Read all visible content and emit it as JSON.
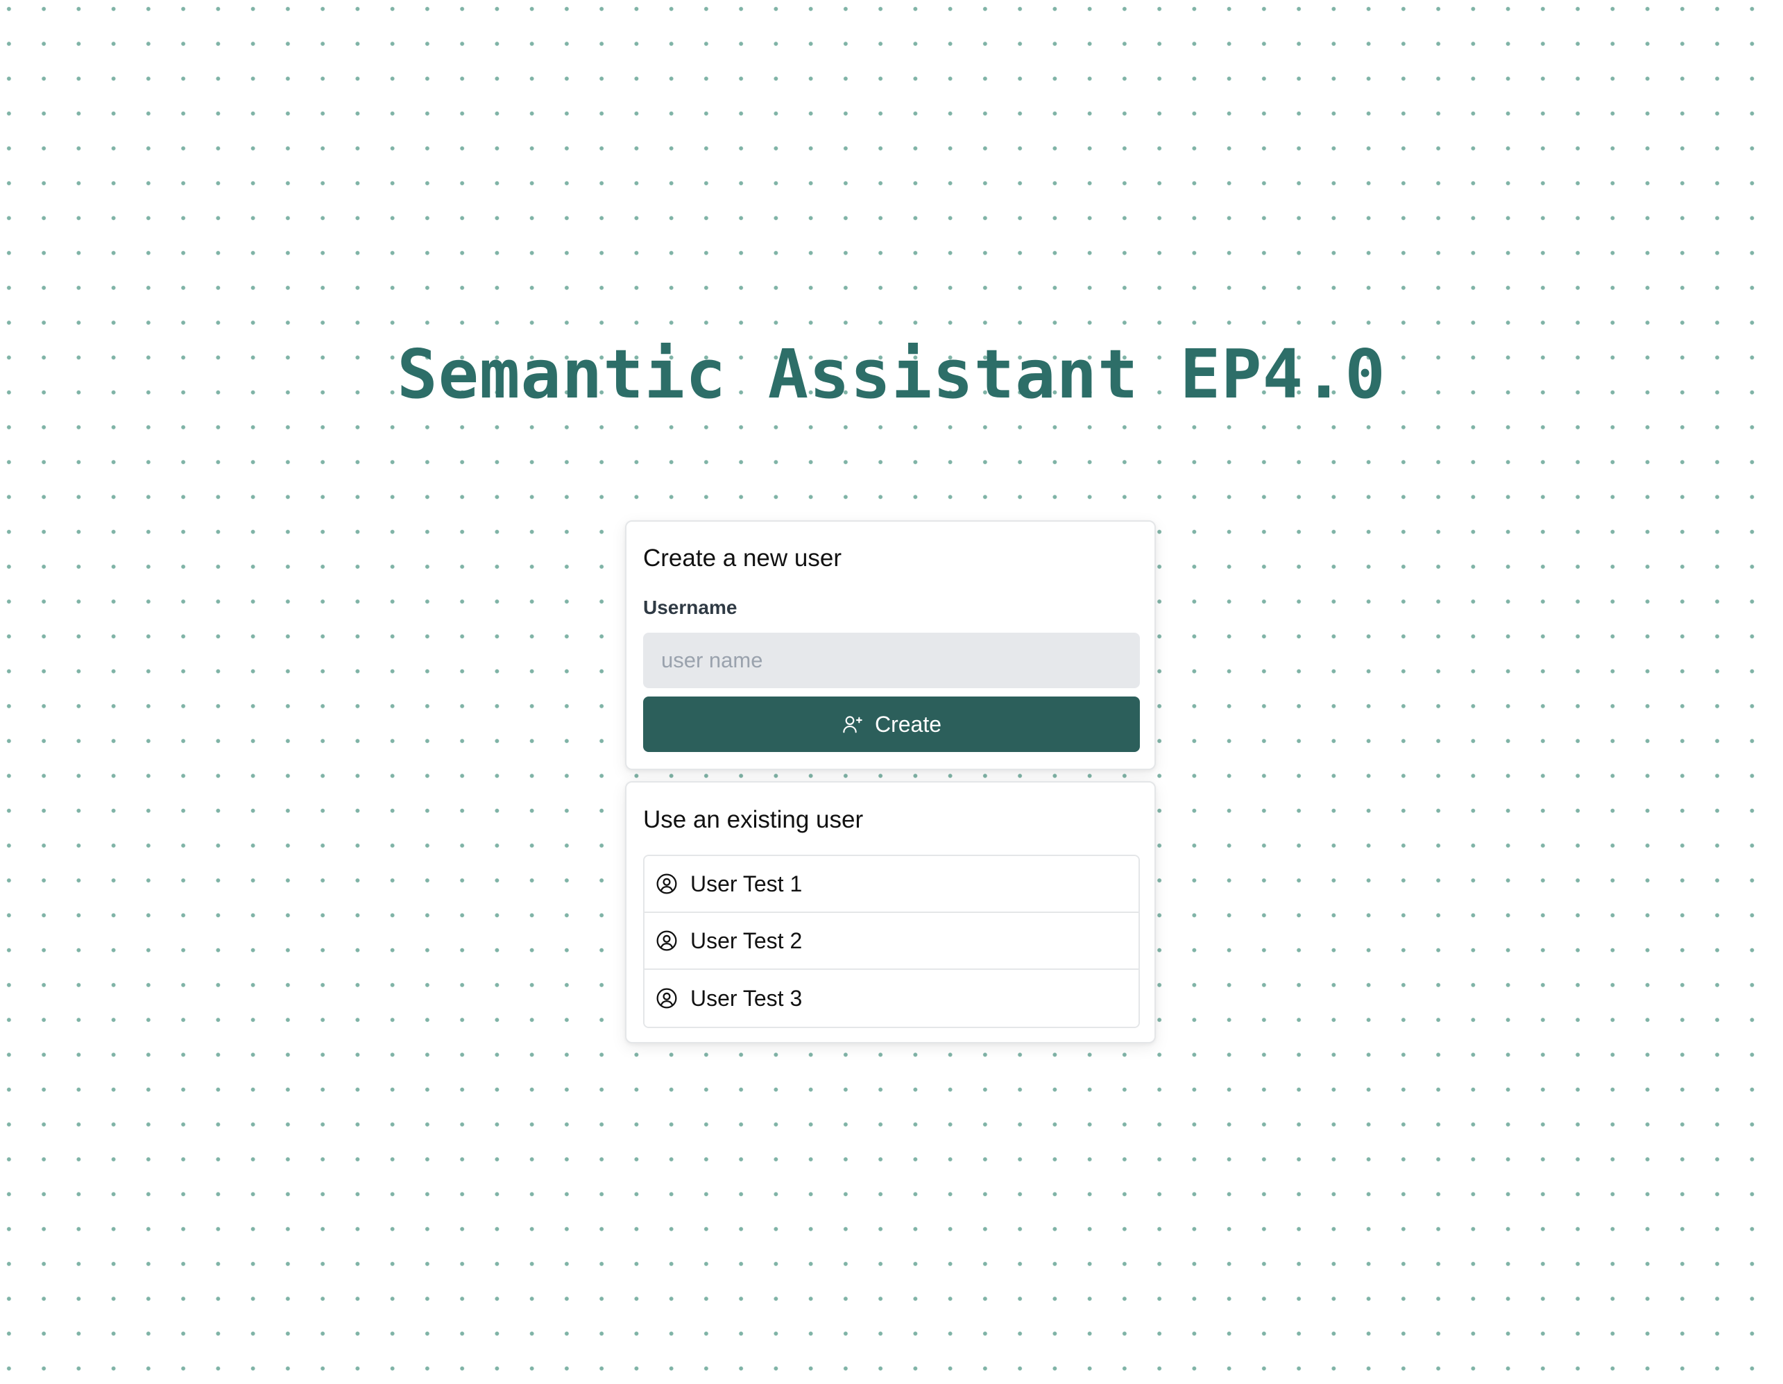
{
  "app": {
    "title": "Semantic Assistant EP4.0"
  },
  "create_user": {
    "heading": "Create a new user",
    "username_label": "Username",
    "username_value": "",
    "username_placeholder": "user name",
    "create_button_label": "Create",
    "create_button_icon": "user-plus-icon"
  },
  "existing_users": {
    "heading": "Use an existing user",
    "user_icon": "user-circle-icon",
    "users": [
      {
        "name": "User Test 1"
      },
      {
        "name": "User Test 2"
      },
      {
        "name": "User Test 3"
      }
    ]
  },
  "colors": {
    "brand": "#2d6e68",
    "button_background": "#2c5f5b",
    "input_background": "#e6e8eb",
    "dot_pattern": "#7fb3a6"
  }
}
